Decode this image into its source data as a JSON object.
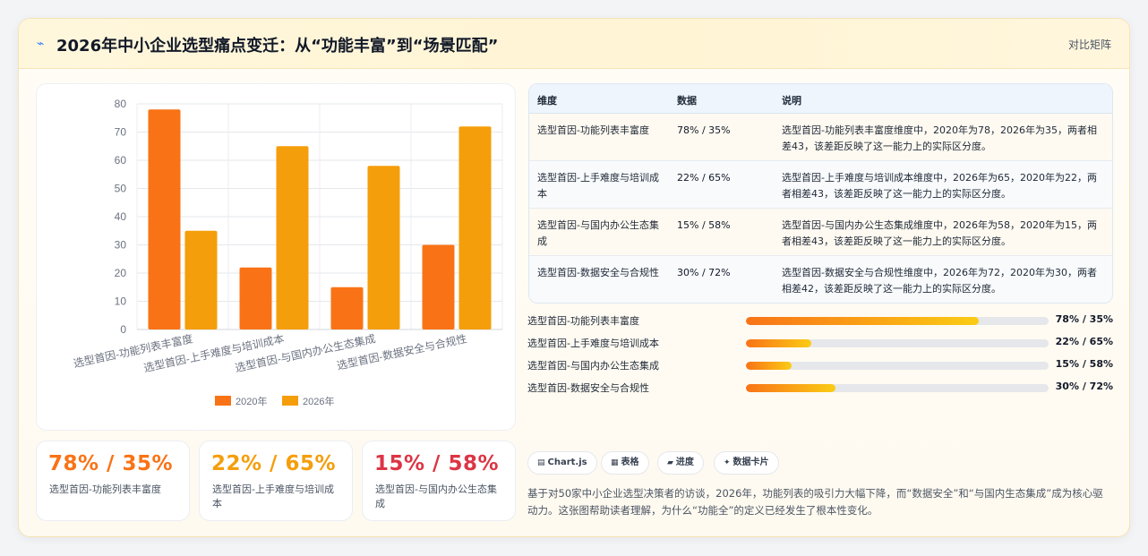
{
  "header": {
    "title": "2026年中小企业选型痛点变迁：从“功能丰富”到“场景匹配”",
    "tag": "对比矩阵",
    "icon": "sparkle-icon"
  },
  "chart_data": {
    "type": "bar",
    "categories": [
      "选型首因-功能列表丰富度",
      "选型首因-上手难度与培训成本",
      "选型首因-与国内办公生态集成",
      "选型首因-数据安全与合规性"
    ],
    "series": [
      {
        "name": "2020年",
        "values": [
          78,
          22,
          15,
          30
        ],
        "color": "#f97316"
      },
      {
        "name": "2026年",
        "values": [
          35,
          65,
          58,
          72
        ],
        "color": "#f59e0b"
      }
    ],
    "ylim": [
      0,
      80
    ],
    "yticks": [
      0,
      10,
      20,
      30,
      40,
      50,
      60,
      70,
      80
    ],
    "grid": true,
    "legend": "bottom"
  },
  "stats": [
    {
      "value": "78% / 35%",
      "label": "选型首因-功能列表丰富度",
      "color": "#f97316"
    },
    {
      "value": "22% / 65%",
      "label": "选型首因-上手难度与培训成本",
      "color": "#f59e0b"
    },
    {
      "value": "15% / 58%",
      "label": "选型首因-与国内办公生态集成",
      "color": "#dc3545"
    }
  ],
  "table": {
    "headers": [
      "维度",
      "数据",
      "说明"
    ],
    "rows": [
      [
        "选型首因-功能列表丰富度",
        "78% / 35%",
        "选型首因-功能列表丰富度维度中，2020年为78，2026年为35，两者相差43，该差距反映了这一能力上的实际区分度。"
      ],
      [
        "选型首因-上手难度与培训成本",
        "22% / 65%",
        "选型首因-上手难度与培训成本维度中，2026年为65，2020年为22，两者相差43，该差距反映了这一能力上的实际区分度。"
      ],
      [
        "选型首因-与国内办公生态集成",
        "15% / 58%",
        "选型首因-与国内办公生态集成维度中，2026年为58，2020年为15，两者相差43，该差距反映了这一能力上的实际区分度。"
      ],
      [
        "选型首因-数据安全与合规性",
        "30% / 72%",
        "选型首因-数据安全与合规性维度中，2026年为72，2020年为30，两者相差42，该差距反映了这一能力上的实际区分度。"
      ]
    ]
  },
  "progress": [
    {
      "label": "选型首因-功能列表丰富度",
      "value": "78% / 35%",
      "percent": 77
    },
    {
      "label": "选型首因-上手难度与培训成本",
      "value": "22% / 65%",
      "percent": 21.5
    },
    {
      "label": "选型首因-与国内办公生态集成",
      "value": "15% / 58%",
      "percent": 15
    },
    {
      "label": "选型首因-数据安全与合规性",
      "value": "30% / 72%",
      "percent": 29.5
    }
  ],
  "chips": [
    {
      "icon": "chart-icon",
      "glyph": "▤",
      "label": "Chart.js"
    },
    {
      "icon": "table-icon",
      "glyph": "▦",
      "label": "表格"
    },
    {
      "icon": "progress-icon",
      "glyph": "▰",
      "label": "进度"
    },
    {
      "icon": "sparkle-icon",
      "glyph": "✦",
      "label": "数据卡片"
    }
  ],
  "description": "基于对50家中小企业选型决策者的访谈，2026年，功能列表的吸引力大幅下降，而“数据安全”和“与国内生态集成”成为核心驱动力。这张图帮助读者理解，为什么“功能全”的定义已经发生了根本性变化。"
}
